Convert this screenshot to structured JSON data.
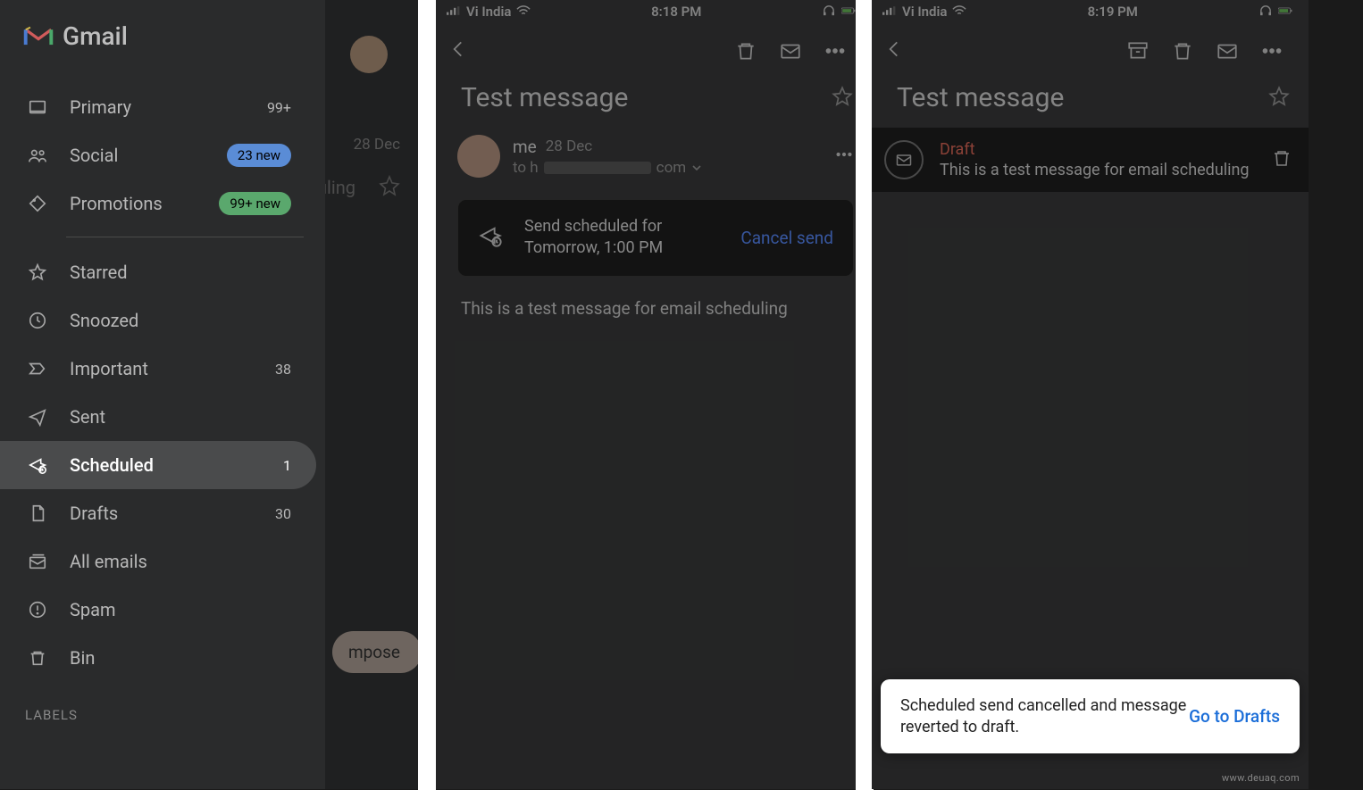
{
  "panel1": {
    "app_name": "Gmail",
    "background": {
      "date": "28 Dec",
      "partial_text": "uling",
      "compose": "mpose"
    },
    "sidebar": {
      "items": [
        {
          "icon": "primary",
          "label": "Primary",
          "badge": "99+",
          "badge_type": "text"
        },
        {
          "icon": "social",
          "label": "Social",
          "badge": "23 new",
          "badge_type": "blue"
        },
        {
          "icon": "promotions",
          "label": "Promotions",
          "badge": "99+ new",
          "badge_type": "green"
        }
      ],
      "folders": [
        {
          "icon": "star",
          "label": "Starred",
          "badge": ""
        },
        {
          "icon": "snoozed",
          "label": "Snoozed",
          "badge": ""
        },
        {
          "icon": "important",
          "label": "Important",
          "badge": "38"
        },
        {
          "icon": "sent",
          "label": "Sent",
          "badge": ""
        },
        {
          "icon": "scheduled",
          "label": "Scheduled",
          "badge": "1",
          "active": true
        },
        {
          "icon": "drafts",
          "label": "Drafts",
          "badge": "30"
        },
        {
          "icon": "allmail",
          "label": "All emails",
          "badge": ""
        },
        {
          "icon": "spam",
          "label": "Spam",
          "badge": ""
        },
        {
          "icon": "bin",
          "label": "Bin",
          "badge": ""
        }
      ],
      "labels_header": "LABELS"
    }
  },
  "panel2": {
    "status": {
      "carrier": "Vi India",
      "time": "8:18 PM"
    },
    "subject": "Test message",
    "sender": {
      "name": "me",
      "date": "28 Dec",
      "to_prefix": "to h",
      "to_suffix": "com"
    },
    "schedule": {
      "line1": "Send scheduled for",
      "line2": "Tomorrow, 1:00 PM",
      "cancel": "Cancel send"
    },
    "body": "This is a test message for email scheduling"
  },
  "panel3": {
    "status": {
      "carrier": "Vi India",
      "time": "8:19 PM"
    },
    "subject": "Test message",
    "draft": {
      "label": "Draft",
      "preview": "This is a test message for email scheduling"
    },
    "toast": {
      "text": "Scheduled send cancelled and message reverted to draft.",
      "action": "Go to Drafts"
    }
  },
  "watermark": "www.deuaq.com"
}
